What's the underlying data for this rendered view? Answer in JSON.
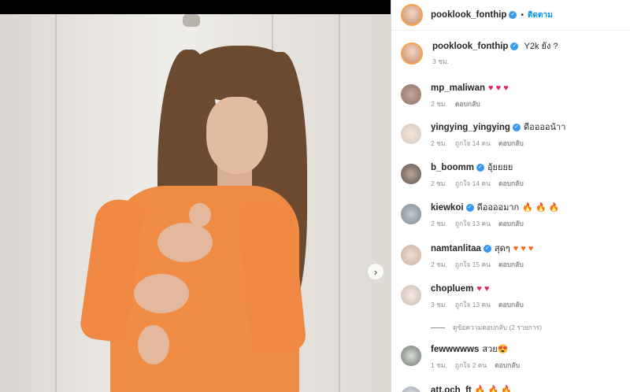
{
  "post": {
    "author": "pooklook_fonthip",
    "follow_label": "ติดตาม",
    "separator": "•",
    "next_icon": "chevron-right"
  },
  "caption": {
    "username": "pooklook_fonthip",
    "text": "Y2k ยัง ?",
    "time": "3 ชม."
  },
  "comments": [
    {
      "username": "mp_maliwan",
      "verified": false,
      "text": "",
      "emoji": "♥ ♥ ♥",
      "emoji_kind": "heart",
      "time": "2 ชม.",
      "likes": "",
      "reply": "ตอบกลับ"
    },
    {
      "username": "yingying_yingying",
      "verified": true,
      "text": "ดีออออน้าา",
      "emoji": "",
      "emoji_kind": "",
      "time": "2 ชม.",
      "likes": "ถูกใจ 14 คน",
      "reply": "ตอบกลับ"
    },
    {
      "username": "b_boomm",
      "verified": true,
      "text": "อุ้ยยยย",
      "emoji": "",
      "emoji_kind": "",
      "time": "2 ชม.",
      "likes": "ถูกใจ 14 คน",
      "reply": "ตอบกลับ"
    },
    {
      "username": "kiewkoi",
      "verified": true,
      "text": "ดีออออมาก",
      "emoji": "🔥 🔥 🔥",
      "emoji_kind": "fire",
      "time": "2 ชม.",
      "likes": "ถูกใจ 13 คน",
      "reply": "ตอบกลับ"
    },
    {
      "username": "namtanlitaa",
      "verified": true,
      "text": "สุดๆ",
      "emoji": "♥ ♥ ♥",
      "emoji_kind": "fire",
      "time": "2 ชม.",
      "likes": "ถูกใจ 15 คน",
      "reply": "ตอบกลับ"
    },
    {
      "username": "chopluem",
      "verified": false,
      "text": "",
      "emoji": "♥ ♥",
      "emoji_kind": "heart",
      "time": "3 ชม.",
      "likes": "ถูกใจ 13 คน",
      "reply": "ตอบกลับ"
    },
    {
      "username": "fewwwwws",
      "verified": false,
      "text": "สวย",
      "emoji": "😍",
      "emoji_kind": "heart",
      "time": "1 ชม.",
      "likes": "ถูกใจ 2 คน",
      "reply": "ตอบกลับ"
    },
    {
      "username": "att.och_ft",
      "verified": false,
      "text": "",
      "emoji": "🔥 🔥 🔥",
      "emoji_kind": "fire",
      "time": "",
      "likes": "",
      "reply": ""
    }
  ],
  "view_replies": "ดูข้อความตอบกลับ (2 รายการ)",
  "colors": {
    "accent": "#0095f6",
    "verified": "#3897f0",
    "heart": "#e0245e",
    "fire": "#f06a19"
  }
}
